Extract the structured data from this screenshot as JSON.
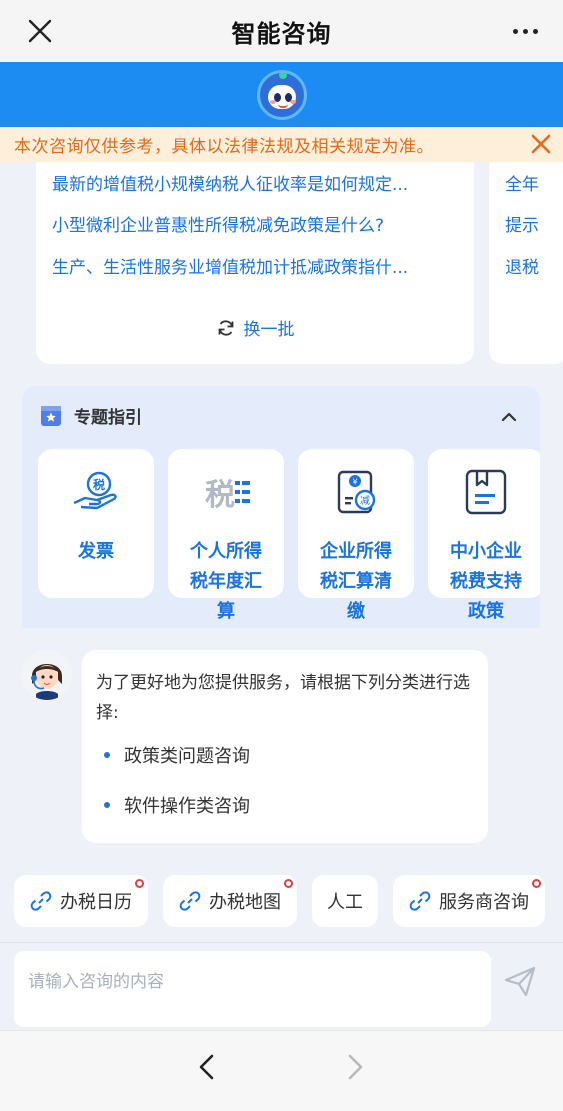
{
  "header": {
    "title": "智能咨询"
  },
  "notice": {
    "text": "本次咨询仅供参考，具体以法律法规及相关规定为准。"
  },
  "questions": {
    "col1": [
      "最新的增值税小规模纳税人征收率是如何规定...",
      "小型微利企业普惠性所得税减免政策是什么?",
      "生产、生活性服务业增值税加计抵减政策指什..."
    ],
    "col2": [
      "全年",
      "提示",
      "退税"
    ],
    "refresh_label": "换一批"
  },
  "guide": {
    "title": "专题指引",
    "tiles": [
      {
        "label": "发票",
        "icon": "invoice-hand-icon"
      },
      {
        "label": "个人所得税年度汇算",
        "icon": "tax-doc-icon"
      },
      {
        "label": "企业所得税汇算清缴",
        "icon": "money-bag-icon"
      },
      {
        "label": "中小企业税费支持政策",
        "icon": "bookmark-doc-icon"
      }
    ]
  },
  "chat": {
    "intro": "为了更好地为您提供服务，请根据下列分类进行选择:",
    "options": [
      "政策类问题咨询",
      "软件操作类咨询"
    ]
  },
  "shortcuts": [
    {
      "label": "办税日历",
      "icon": "link-icon",
      "badge": true
    },
    {
      "label": "办税地图",
      "icon": "link-icon",
      "badge": true
    },
    {
      "label": "人工",
      "icon": "",
      "badge": false
    },
    {
      "label": "服务商咨询",
      "icon": "link-icon",
      "badge": true
    }
  ],
  "input": {
    "placeholder": "请输入咨询的内容"
  },
  "colors": {
    "primary": "#1b73e0",
    "banner": "#1c8bf2",
    "notice_text": "#e26a1a",
    "notice_bg": "#fdefd9"
  }
}
